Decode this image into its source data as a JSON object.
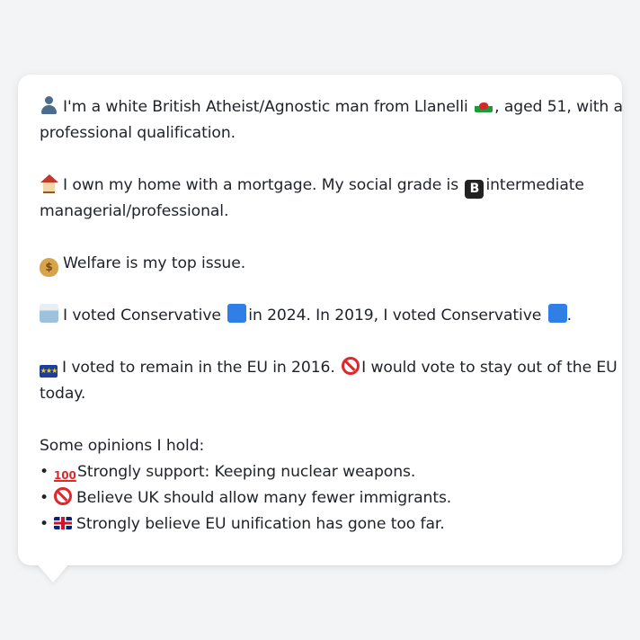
{
  "profile": {
    "p1_a": "I'm a white British Atheist/Agnostic man from Llanelli",
    "p1_b": ", aged 51, with a",
    "p1_c": "professional qualification.",
    "p2_a": "I own my home with a mortgage. My social grade is",
    "p2_b": "intermediate",
    "p2_c": "managerial/professional.",
    "p3": "Welfare is my top issue.",
    "p4_a": "I voted Conservative",
    "p4_b": "in 2024. In 2019, I voted Conservative",
    "p4_c": ".",
    "p5_a": "I voted to remain in the EU in 2016.",
    "p5_b": "I would vote to stay out of the EU",
    "p5_c": "today.",
    "opinions_heading": "Some opinions I hold:",
    "opinions": [
      "Strongly support: Keeping nuclear weapons.",
      "Believe UK should allow many fewer immigrants.",
      "Strongly believe EU unification has gone too far."
    ],
    "bullet": "•",
    "social_grade_letter": "B",
    "icons": {
      "person": "bust-in-silhouette-icon",
      "wales": "wales-flag-icon",
      "home": "house-icon",
      "grade": "b-button-icon",
      "welfare": "money-bag-icon",
      "vote": "ballot-box-icon",
      "party": "blue-square-icon",
      "eu": "eu-flag-icon",
      "no": "prohibited-icon",
      "hundred": "hundred-points-icon",
      "uk": "uk-flag-icon"
    },
    "colors": {
      "bubble_bg": "#ffffff",
      "page_bg": "#f3f4f6",
      "conservative_blue": "#2f7fe6"
    }
  }
}
